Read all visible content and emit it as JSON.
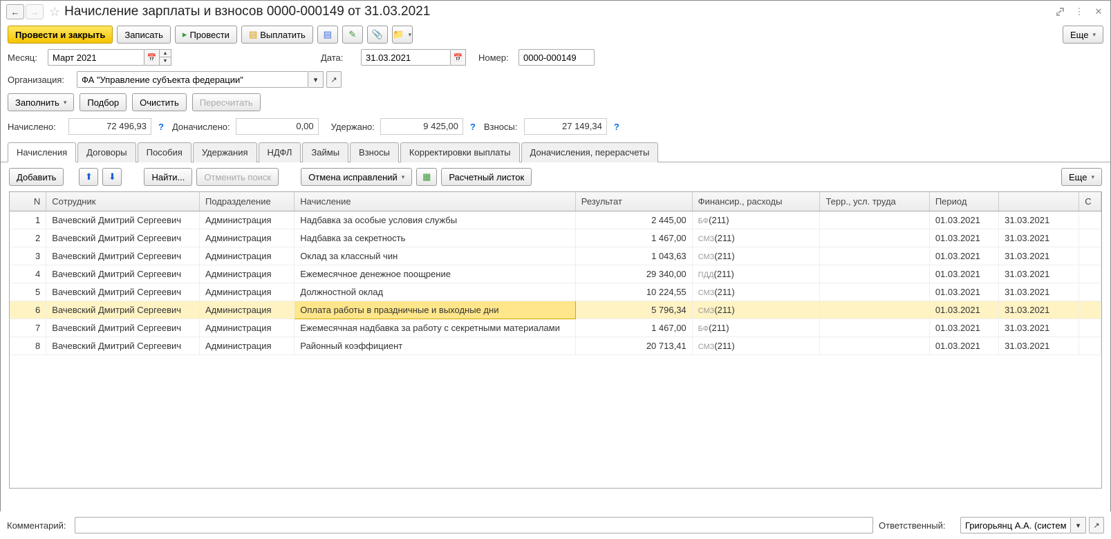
{
  "title": "Начисление зарплаты и взносов 0000-000149 от 31.03.2021",
  "toolbar": {
    "post_close": "Провести и закрыть",
    "save": "Записать",
    "post": "Провести",
    "pay": "Выплатить",
    "more": "Еще"
  },
  "form": {
    "month_label": "Месяц:",
    "month": "Март 2021",
    "date_label": "Дата:",
    "date": "31.03.2021",
    "number_label": "Номер:",
    "number": "0000-000149",
    "org_label": "Организация:",
    "org": "ФА \"Управление субъекта федерации\""
  },
  "actions": {
    "fill": "Заполнить",
    "select": "Подбор",
    "clear": "Очистить",
    "recalc": "Пересчитать"
  },
  "totals": {
    "accrued_label": "Начислено:",
    "accrued": "72 496,93",
    "additional_label": "Доначислено:",
    "additional": "0,00",
    "withheld_label": "Удержано:",
    "withheld": "9 425,00",
    "contrib_label": "Взносы:",
    "contrib": "27 149,34"
  },
  "tabs": [
    "Начисления",
    "Договоры",
    "Пособия",
    "Удержания",
    "НДФЛ",
    "Займы",
    "Взносы",
    "Корректировки выплаты",
    "Доначисления, перерасчеты"
  ],
  "tab_toolbar": {
    "add": "Добавить",
    "find": "Найти...",
    "cancel_search": "Отменить поиск",
    "undo_fixes": "Отмена исправлений",
    "payslip": "Расчетный листок",
    "more": "Еще"
  },
  "columns": [
    "N",
    "Сотрудник",
    "Подразделение",
    "Начисление",
    "Результат",
    "Финансир., расходы",
    "Терр., усл. труда",
    "Период",
    "",
    "С"
  ],
  "rows": [
    {
      "n": "1",
      "emp": "Вачевский Дмитрий Сергеевич",
      "dept": "Администрация",
      "acc": "Надбавка за особые условия службы",
      "res": "2 445,00",
      "fin": "БФ(211)",
      "terr": "",
      "p1": "01.03.2021",
      "p2": "31.03.2021"
    },
    {
      "n": "2",
      "emp": "Вачевский Дмитрий Сергеевич",
      "dept": "Администрация",
      "acc": "Надбавка за секретность",
      "res": "1 467,00",
      "fin": "СМЗ(211)",
      "terr": "",
      "p1": "01.03.2021",
      "p2": "31.03.2021"
    },
    {
      "n": "3",
      "emp": "Вачевский Дмитрий Сергеевич",
      "dept": "Администрация",
      "acc": "Оклад за классный чин",
      "res": "1 043,63",
      "fin": "СМЗ(211)",
      "terr": "",
      "p1": "01.03.2021",
      "p2": "31.03.2021"
    },
    {
      "n": "4",
      "emp": "Вачевский Дмитрий Сергеевич",
      "dept": "Администрация",
      "acc": "Ежемесячное денежное поощрение",
      "res": "29 340,00",
      "fin": "ПДД(211)",
      "terr": "",
      "p1": "01.03.2021",
      "p2": "31.03.2021"
    },
    {
      "n": "5",
      "emp": "Вачевский Дмитрий Сергеевич",
      "dept": "Администрация",
      "acc": "Должностной оклад",
      "res": "10 224,55",
      "fin": "СМЗ(211)",
      "terr": "",
      "p1": "01.03.2021",
      "p2": "31.03.2021"
    },
    {
      "n": "6",
      "emp": "Вачевский Дмитрий Сергеевич",
      "dept": "Администрация",
      "acc": "Оплата работы в праздничные и выходные дни",
      "res": "5 796,34",
      "fin": "СМЗ(211)",
      "terr": "",
      "p1": "01.03.2021",
      "p2": "31.03.2021"
    },
    {
      "n": "7",
      "emp": "Вачевский Дмитрий Сергеевич",
      "dept": "Администрация",
      "acc": "Ежемесячная надбавка за работу с секретными материалами",
      "res": "1 467,00",
      "fin": "БФ(211)",
      "terr": "",
      "p1": "01.03.2021",
      "p2": "31.03.2021"
    },
    {
      "n": "8",
      "emp": "Вачевский Дмитрий Сергеевич",
      "dept": "Администрация",
      "acc": "Районный коэффициент",
      "res": "20 713,41",
      "fin": "СМЗ(211)",
      "terr": "",
      "p1": "01.03.2021",
      "p2": "31.03.2021"
    }
  ],
  "selected_row": 5,
  "footer": {
    "comment_label": "Комментарий:",
    "comment": "",
    "resp_label": "Ответственный:",
    "resp": "Григорьянц А.А. (системн"
  }
}
